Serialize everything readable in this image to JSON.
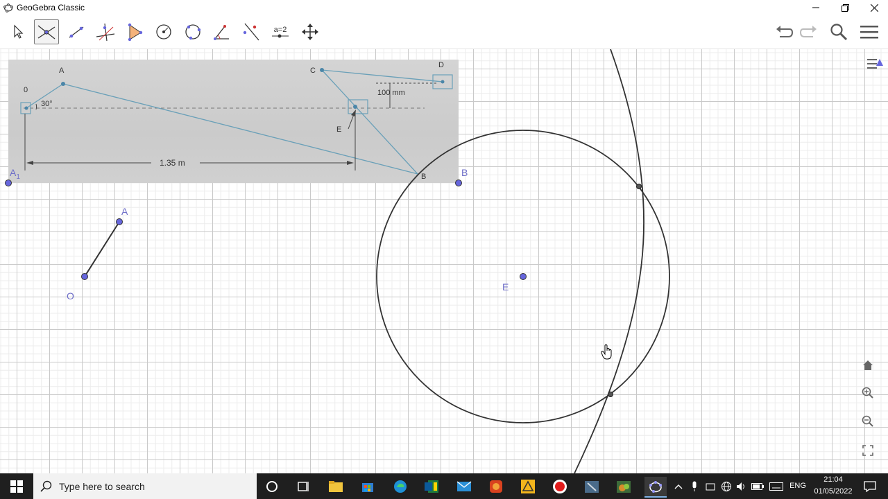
{
  "window": {
    "title": "GeoGebra Classic"
  },
  "toolbar": {
    "tools": [
      {
        "name": "move-tool"
      },
      {
        "name": "intersect-tool",
        "selected": true
      },
      {
        "name": "line-tool"
      },
      {
        "name": "perpendicular-line-tool"
      },
      {
        "name": "polygon-tool"
      },
      {
        "name": "circle-center-point-tool"
      },
      {
        "name": "circle-three-points-tool"
      },
      {
        "name": "angle-tool"
      },
      {
        "name": "reflect-tool"
      },
      {
        "name": "slider-tool",
        "label": "a=2"
      },
      {
        "name": "move-graphics-view-tool"
      }
    ]
  },
  "photo": {
    "labels": {
      "o": "0",
      "a": "A",
      "c": "C",
      "d": "D",
      "e": "E",
      "b": "B",
      "angle": "30°",
      "dim_vertical": "100 mm",
      "dim_horizontal": "1.35 m"
    }
  },
  "points": {
    "a1": "A",
    "a1_sub": "1",
    "b": "B",
    "a": "A",
    "o": "O",
    "e": "E"
  },
  "taskbar": {
    "search_placeholder": "Type here to search",
    "language": "ENG",
    "time": "21:04",
    "date": "01/05/2022"
  },
  "colors": {
    "point": "#6666dd",
    "accent": "#6557d2"
  }
}
